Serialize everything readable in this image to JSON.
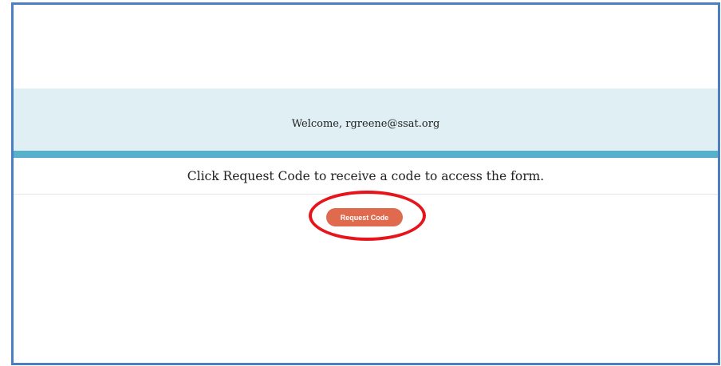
{
  "welcome": {
    "text": "Welcome, rgreene@ssat.org"
  },
  "instruction": {
    "text": "Click Request Code to receive a code to access the form."
  },
  "request_button": {
    "label": "Request Code"
  },
  "colors": {
    "frame_border": "#4a7fc1",
    "welcome_band": "#dfeff4",
    "accent_bar": "#58b1cc",
    "button": "#e06a4e",
    "highlight": "#e8141b"
  }
}
